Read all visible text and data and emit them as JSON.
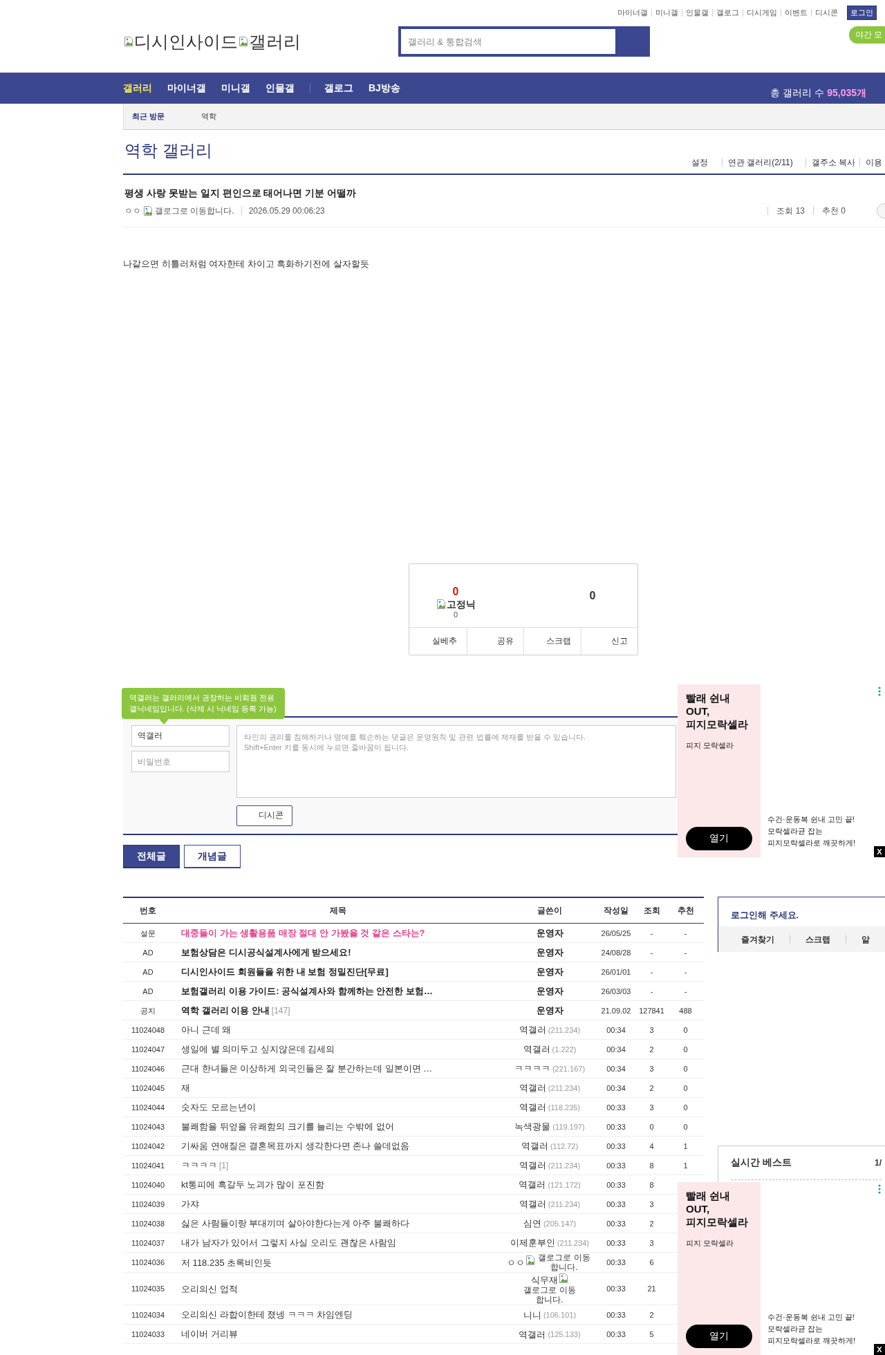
{
  "top_links": [
    "마이너갤",
    "미니갤",
    "인물갤",
    "갤로그",
    "디시게임",
    "이벤트",
    "디시콘"
  ],
  "login_button": "로그인",
  "night_mode_button": "야간 모",
  "logo": {
    "parts": [
      "디시인사이드",
      "갤러리"
    ]
  },
  "search": {
    "placeholder": "갤러리 & 통합검색"
  },
  "nav": {
    "main_items": [
      {
        "label": "갤러리",
        "selected": true
      },
      {
        "label": "마이너갤",
        "selected": false
      },
      {
        "label": "미니갤",
        "selected": false
      },
      {
        "label": "인물갤",
        "selected": false
      }
    ],
    "extra_items": [
      {
        "label": "갤로그",
        "selected": false
      },
      {
        "label": "BJ방송",
        "selected": false
      }
    ],
    "count_label": "총 갤러리 수",
    "count": "95,035개"
  },
  "recent": {
    "label": "최근 방문",
    "items": [
      "역학"
    ]
  },
  "gallery": {
    "title": "역학 갤러리",
    "links": [
      "설정",
      "연관 갤러리(2/11)",
      "갤주소 복사",
      "이용"
    ]
  },
  "post": {
    "title": "평생 사랑 못받는 일지 편인으로 태어나면 기분 어떨까",
    "author": "ㅇㅇ",
    "author_icon_alt": "갤로그로 이동합니다.",
    "date": "2026.05.29 00:06:23",
    "views": "조회 13",
    "recommends": "추천 0",
    "body": "나같으면 히틀러처럼 여자한테 차이고 흑화하기전에 살자할듯"
  },
  "recommend": {
    "up_count": "0",
    "fixed_nick_alt": "고정닉",
    "fixed_nick_count": "0",
    "down_count": "0",
    "buttons": [
      "실베추",
      "공유",
      "스크랩",
      "신고"
    ]
  },
  "comment": {
    "tooltip": "역갤러는 갤러리에서 권장하는 비회원 전용\n갤닉네임입니다. (삭제 시 닉네임 등록 가능)",
    "name_value": "역갤러",
    "password_placeholder": "비밀번호",
    "text_placeholder": "타인의 권리를 침해하거나 명예를 훼손하는 댓글은 운영원칙 및 관련 법률에 제재를 받을 수 있습니다.\nShift+Enter 키를 동시에 누르면 줄바꿈이 됩니다.",
    "dccon_button": "디시콘"
  },
  "list_tabs": [
    {
      "label": "전체글",
      "selected": true
    },
    {
      "label": "개념글",
      "selected": false
    }
  ],
  "table": {
    "columns": [
      "번호",
      "제목",
      "글쓴이",
      "작성일",
      "조회",
      "추천"
    ],
    "rows": [
      {
        "kind": "survey",
        "number": "설문",
        "title": "대중들이 가는 생활용품 매장 절대 안 가봤을 것 같은 스타는?",
        "writer": "운영자",
        "date": "26/05/25",
        "views": "-",
        "recommends": "-"
      },
      {
        "kind": "ad",
        "number": "AD",
        "title": "보험상담은 디시공식설계사에게 받으세요!",
        "writer": "운영자",
        "date": "24/08/28",
        "views": "-",
        "recommends": "-"
      },
      {
        "kind": "ad",
        "number": "AD",
        "title": "디시인사이드 회원들을 위한 내 보험 정밀진단[무료]",
        "writer": "운영자",
        "date": "26/01/01",
        "views": "-",
        "recommends": "-"
      },
      {
        "kind": "ad",
        "number": "AD",
        "title": "보험갤러리 이용 가이드: 공식설계사와 함께하는 안전한 보험…",
        "writer": "운영자",
        "date": "26/03/03",
        "views": "-",
        "recommends": "-"
      },
      {
        "kind": "notice",
        "number": "공지",
        "title": "역학 갤러리 이용 안내",
        "comments": "[147]",
        "writer": "운영자",
        "date": "21.09.02",
        "views": "127841",
        "recommends": "488"
      },
      {
        "kind": "post",
        "number": "11024048",
        "title": "아니 근데 왜",
        "writer": "역갤러",
        "ip": "(211.234)",
        "date": "00:34",
        "views": "3",
        "recommends": "0"
      },
      {
        "kind": "post",
        "number": "11024047",
        "title": "생일에 별 의미두고 싶지않은데 김세의",
        "writer": "역갤러",
        "ip": "(1.222)",
        "date": "00:34",
        "views": "2",
        "recommends": "0"
      },
      {
        "kind": "post",
        "number": "11024046",
        "title": "근대 한녀들은 이상하게 외국인들은 잘 분간하는데 일본이면 …",
        "writer": "ㅋㅋㅋㅋ",
        "ip": "(221.167)",
        "date": "00:34",
        "views": "3",
        "recommends": "0"
      },
      {
        "kind": "post",
        "number": "11024045",
        "title": "재",
        "writer": "역갤러",
        "ip": "(211.234)",
        "date": "00:34",
        "views": "2",
        "recommends": "0"
      },
      {
        "kind": "post",
        "number": "11024044",
        "title": "숫자도 모르는년이",
        "writer": "역갤러",
        "ip": "(118.235)",
        "date": "00:33",
        "views": "3",
        "recommends": "0"
      },
      {
        "kind": "post",
        "number": "11024043",
        "title": "불쾌함을 뒤엎을 유쾌함의 크기를 늘리는 수밖에 없어",
        "writer": "녹색광물",
        "ip": "(119.197)",
        "date": "00:33",
        "views": "0",
        "recommends": "0"
      },
      {
        "kind": "post",
        "number": "11024042",
        "title": "기싸움 연애질은 결혼목표까지 생각한다면 존나 쓸데없음",
        "writer": "역갤러",
        "ip": "(112.72)",
        "date": "00:33",
        "views": "4",
        "recommends": "1"
      },
      {
        "kind": "post",
        "number": "11024041",
        "title": "ㅋㅋㅋㅋ",
        "comments": "[1]",
        "writer": "역갤러",
        "ip": "(211.234)",
        "date": "00:33",
        "views": "8",
        "recommends": "1"
      },
      {
        "kind": "post",
        "number": "11024040",
        "title": "kt통피에 흑갈두 노괴가 많이 포진함",
        "writer": "역갤러",
        "ip": "(121.172)",
        "date": "00:33",
        "views": "8"
      },
      {
        "kind": "post",
        "number": "11024039",
        "title": "가쟈",
        "writer": "역갤러",
        "ip": "(211.234)",
        "date": "00:33",
        "views": "3"
      },
      {
        "kind": "post",
        "number": "11024038",
        "title": "싫은 사람들이랑 부대끼며 살아야한다는게 아주 불쾌하다",
        "writer": "심연",
        "ip": "(205.147)",
        "date": "00:33",
        "views": "2"
      },
      {
        "kind": "post",
        "number": "11024037",
        "title": "내가 남자가 있어서 그렇지 사실 오리도 괜찮은 사람임",
        "writer": "이제훈부인",
        "ip": "(211.234)",
        "date": "00:33",
        "views": "3"
      },
      {
        "kind": "post",
        "number": "11024036",
        "title": "저 118.235 초록비인듯",
        "writer": "ㅇㅇ",
        "writer_icon_alt": "갤로그로 이동합니다.",
        "date": "00:33",
        "views": "6"
      },
      {
        "kind": "post",
        "number": "11024035",
        "title": "오리의신 업적",
        "writer": "식무재",
        "writer_icon_alt": "갤로그로 이동합니다.",
        "date": "00:33",
        "views": "21"
      },
      {
        "kind": "post",
        "number": "11024034",
        "title": "오리의신 라합이한테 졌넹 ㅋㅋㅋ 차임엔딩",
        "writer": "니니",
        "ip": "(106.101)",
        "date": "00:33",
        "views": "2"
      },
      {
        "kind": "post",
        "number": "11024033",
        "title": "네이버 거리뷰",
        "writer": "역갤러",
        "ip": "(125.133)",
        "date": "00:33",
        "views": "5"
      }
    ]
  },
  "sidebar": {
    "login_prompt": "로그인해 주세요.",
    "links": [
      "즐겨찾기",
      "스크랩",
      "알"
    ],
    "best_title": "실시간 베스트",
    "best_page": "1/"
  },
  "ads": [
    {
      "headline": "빨래 쉰내\nOUT,\n피지모락셀라",
      "brand": "피지 모락셀라",
      "cta": "열기",
      "description": "수건·운동복 쉰내 고민 끝!\n모락셀라균 잡는\n피지모락셀라로 깨끗하게!",
      "close": "X"
    },
    {
      "headline": "빨래 쉰내\nOUT,\n피지모락셀라",
      "brand": "피지 모락셀라",
      "cta": "열기",
      "description": "수건·운동복 쉰내 고민 끝!\n모락셀라균 잡는\n피지모락셀라로 깨끗하게!",
      "close": "X"
    }
  ]
}
